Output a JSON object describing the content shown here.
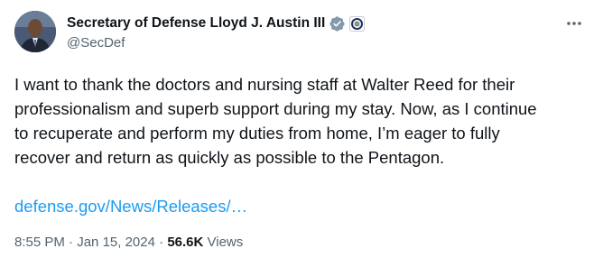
{
  "author": {
    "display_name": "Secretary of Defense Lloyd J. Austin III",
    "handle": "@SecDef",
    "avatar_icon": "profile-photo",
    "verified_icon": "verified-badge-icon",
    "verified_color": "#829aab",
    "affiliation_icon": "dod-seal-icon"
  },
  "tweet": {
    "text": "I want to thank the doctors and nursing staff at Walter Reed for their\nprofessionalism and superb support during my stay. Now, as I continue\nto recuperate and perform my duties from home, I’m eager to fully\nrecover and return as quickly as possible to the Pentagon.",
    "link_text": "defense.gov/News/Releases/…",
    "link_color": "#1d9bf0"
  },
  "meta": {
    "time": "8:55 PM",
    "separator": " · ",
    "date": "Jan 15, 2024",
    "views_count": "56.6K",
    "views_label": "Views"
  },
  "more_icon": "more-horizontal-icon"
}
